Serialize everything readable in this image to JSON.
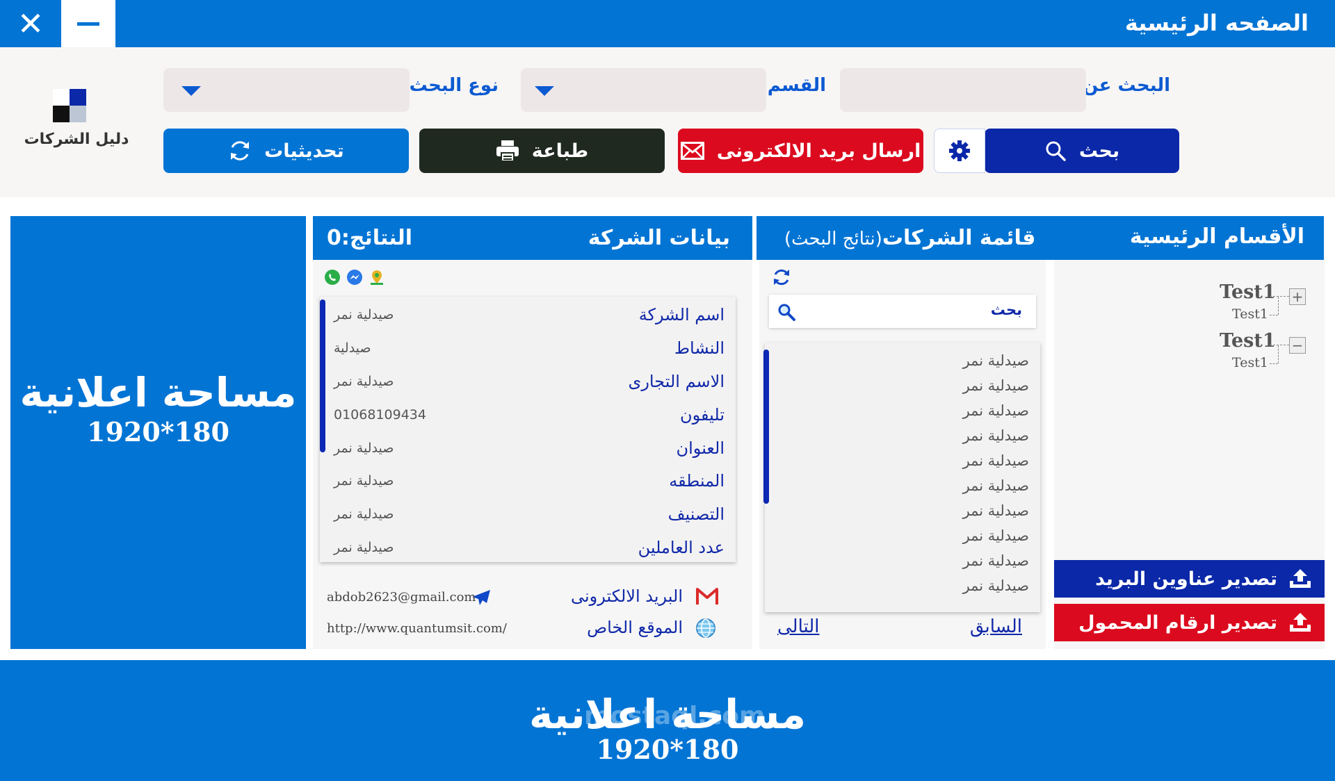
{
  "window": {
    "title": "الصفحه الرئيسية"
  },
  "logo": {
    "text": "دليل الشركات"
  },
  "search": {
    "search_for_label": "البحث عن",
    "section_label": "القسم",
    "search_type_label": "نوع البحث",
    "search_button": "بحث",
    "email_button": "ارسال بريد الالكترونى",
    "print_button": "طباعة",
    "updates_button": "تحديثيات"
  },
  "colors": {
    "primary": "#0274d4",
    "navy": "#0a28a8",
    "red": "#dc0a1e",
    "dark": "#1f2920"
  },
  "ads": {
    "text": "مساحة اعلانية",
    "size": "1920*180"
  },
  "company": {
    "title": "بيانات الشركة",
    "results": "النتائج:0",
    "details": [
      {
        "label": "اسم الشركة",
        "value": "صيدلية نمر"
      },
      {
        "label": "النشاط",
        "value": "صيدلية"
      },
      {
        "label": "الاسم التجارى",
        "value": "صيدلية نمر"
      },
      {
        "label": "تليفون",
        "value": "01068109434"
      },
      {
        "label": "العنوان",
        "value": "صيدلية نمر"
      },
      {
        "label": "المنطقه",
        "value": "صيدلية نمر"
      },
      {
        "label": "التصنيف",
        "value": "صيدلية نمر"
      },
      {
        "label": "عدد العاملين",
        "value": "صيدلية نمر"
      }
    ],
    "email_label": "البريد الالكترونى",
    "email_value": "abdob2623@gmail.com",
    "website_label": "الموقع الخاص",
    "website_value": "http://www.quantumsit.com/"
  },
  "list": {
    "title": "قائمة الشركات",
    "subtitle": "(نتائج البحث)",
    "search_placeholder": "بحث",
    "items": [
      "صيدلية نمر",
      "صيدلية نمر",
      "صيدلية نمر",
      "صيدلية نمر",
      "صيدلية نمر",
      "صيدلية نمر",
      "صيدلية نمر",
      "صيدلية نمر",
      "صيدلية نمر",
      "صيدلية نمر"
    ],
    "prev": "السابق",
    "next": "التالى"
  },
  "tree": {
    "title": "الأقسام الرئيسية",
    "nodes": [
      {
        "label": "Test1",
        "child": "Test1",
        "toggle": "+"
      },
      {
        "label": "Test1",
        "child": "Test1",
        "toggle": "−"
      }
    ],
    "export_email": "تصدير عناوين البريد",
    "export_mobile": "تصدير ارقام المحمول"
  },
  "watermark": "mostaql.com"
}
